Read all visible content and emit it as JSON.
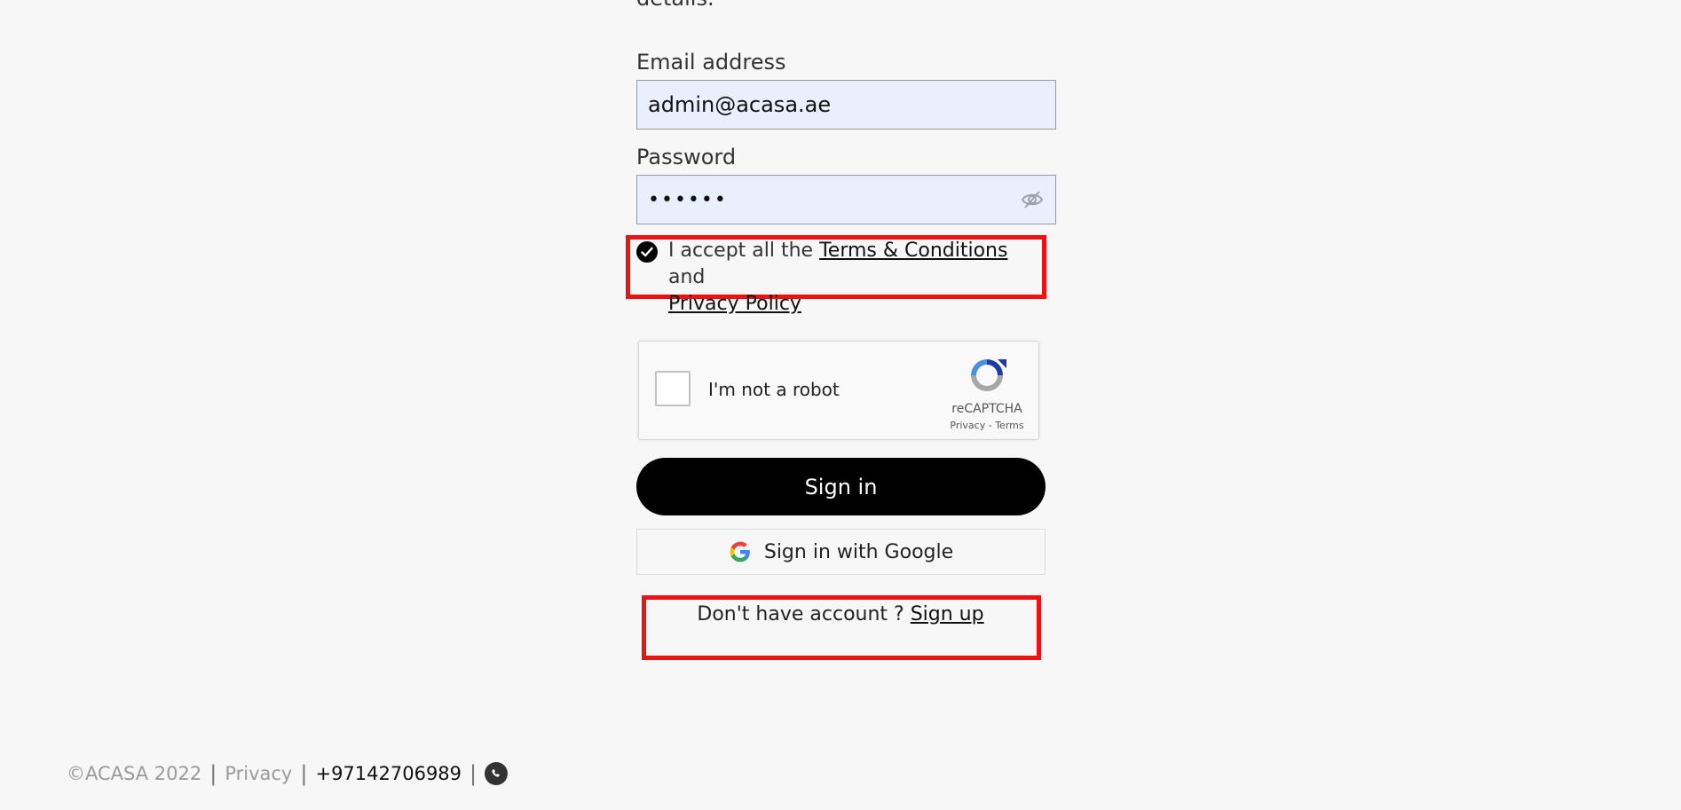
{
  "form": {
    "top_text": "details.",
    "email_label": "Email address",
    "email_value": "admin@acasa.ae",
    "password_label": "Password",
    "password_value": "••••••",
    "terms": {
      "prefix": "I accept all the ",
      "terms_link": "Terms & Conditions",
      "middle": " and",
      "privacy_link": "Privacy Policy"
    },
    "captcha": {
      "label": "I'm not a robot",
      "brand": "reCAPTCHA",
      "links": "Privacy - Terms"
    },
    "signin_label": "Sign in",
    "google_label": "Sign in with Google",
    "signup": {
      "prefix": "Don't have account ? ",
      "link": "Sign up"
    }
  },
  "footer": {
    "copyright": "©ACASA 2022",
    "privacy": "Privacy",
    "phone": "+97142706989"
  },
  "colors": {
    "background": "#f7f7f7",
    "input_fill": "#e8f0fe",
    "primary_button": "#000000",
    "highlight_box": "#ee1111"
  },
  "icons": {
    "password_toggle": "eye-slash-icon",
    "terms_check": "check-circle-icon",
    "captcha_logo": "recaptcha-logo-icon",
    "google": "google-g-icon",
    "whatsapp": "whatsapp-icon"
  }
}
